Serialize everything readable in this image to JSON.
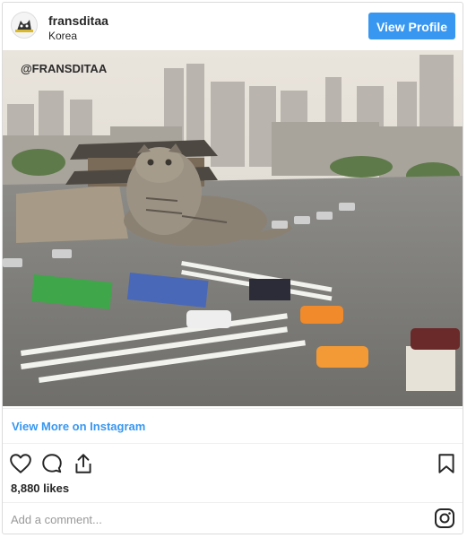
{
  "post": {
    "username": "fransditaa",
    "location": "Korea",
    "view_profile_label": "View Profile",
    "watermark": "@FRANSDITAA",
    "view_more_label": "View More on Instagram",
    "likes": "8,880 likes",
    "comment_placeholder": "Add a comment..."
  },
  "icons": {
    "avatar": "cat-avatar",
    "like": "heart-icon",
    "comment": "comment-icon",
    "share": "share-icon",
    "save": "bookmark-icon",
    "instagram": "instagram-icon"
  },
  "colors": {
    "accent": "#3897f0",
    "border": "#dbdbdb",
    "muted": "#999999"
  }
}
